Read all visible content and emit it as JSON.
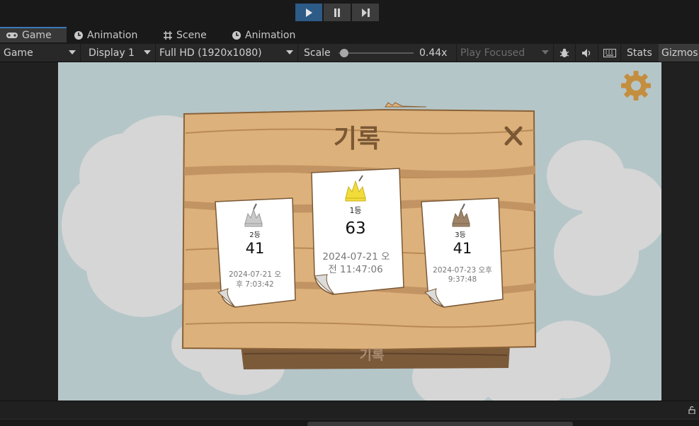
{
  "toolbar_top": {
    "buttons": [
      "play",
      "pause",
      "step"
    ]
  },
  "tabs": [
    {
      "label": "Game",
      "icon": "gamepad-icon"
    },
    {
      "label": "Animation",
      "icon": "animation-clock-icon"
    },
    {
      "label": "Scene",
      "icon": "scene-grid-icon"
    },
    {
      "label": "Animation",
      "icon": "animation-clock-icon"
    }
  ],
  "game_toolbar": {
    "view_select": "Game",
    "display_select": "Display 1",
    "resolution_select": "Full HD (1920x1080)",
    "scale_label": "Scale",
    "scale_value": "0.44x",
    "scale_level": 0.02,
    "play_mode_select": "Play Focused",
    "stats_label": "Stats",
    "gizmos_label": "Gizmos"
  },
  "game": {
    "board_title": "기록",
    "bottom_button": "기록",
    "cards": {
      "first": {
        "rank": "1등",
        "score": "63",
        "date_line1": "2024-07-21 오",
        "date_line2": "전 11:47:06"
      },
      "second": {
        "rank": "2등",
        "score": "41",
        "date_line1": "2024-07-21 오",
        "date_line2": "후 7:03:42"
      },
      "third": {
        "rank": "3등",
        "score": "41",
        "date_line1": "2024-07-23 오후",
        "date_line2": "9:37:48"
      }
    }
  },
  "colors": {
    "play_active": "#2d5b87",
    "tab_accent": "#3a79bb",
    "sky": "#b5c6c8",
    "cloud": "#d6d6d6",
    "board": "#ddb17b",
    "board_dark": "#8a6238",
    "gold_crown": "#f2dc3a",
    "silver_crown": "#c9c9c9",
    "bronze_crown": "#9f8468"
  }
}
